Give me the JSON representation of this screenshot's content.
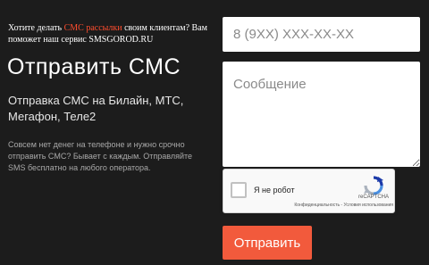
{
  "promo": {
    "prefix": "Хотите делать ",
    "highlight": "СМС рассылки",
    "suffix": " своим клиентам? Вам поможет наш сервис SMSGOROD.RU"
  },
  "title": "Отправить СМС",
  "subtitle": "Отправка СМС на Билайн, МТС, Мегафон, Теле2",
  "description": "Совсем нет денег на телефоне и нужно срочно отправить СМС? Бывает с каждым. Отправляйте SMS бесплатно на любого оператора.",
  "form": {
    "phone_placeholder": "8 (9XX) XXX-XX-XX",
    "message_placeholder": "Сообщение",
    "submit_label": "Отправить"
  },
  "recaptcha": {
    "checkbox_label": "Я не робот",
    "brand": "reCAPTCHA",
    "privacy_link": "Конфиденциальность",
    "separator": " - ",
    "terms_link": "Условия использования",
    "logo_icon": "recaptcha-logo-icon"
  },
  "colors": {
    "background": "#1c1c1c",
    "accent": "#ff4d2e",
    "button": "#f25a3c"
  }
}
